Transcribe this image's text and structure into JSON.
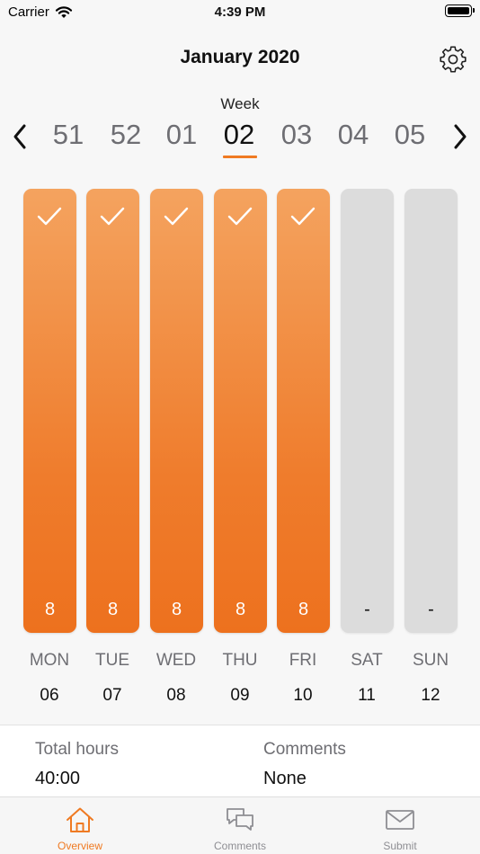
{
  "status_bar": {
    "carrier": "Carrier",
    "time": "4:39 PM"
  },
  "header": {
    "title": "January 2020"
  },
  "week_selector": {
    "label": "Week",
    "weeks": [
      "51",
      "52",
      "01",
      "02",
      "03",
      "04",
      "05"
    ],
    "selected": "02"
  },
  "days": [
    {
      "name": "MON",
      "date": "06",
      "hours": "8",
      "checked": true
    },
    {
      "name": "TUE",
      "date": "07",
      "hours": "8",
      "checked": true
    },
    {
      "name": "WED",
      "date": "08",
      "hours": "8",
      "checked": true
    },
    {
      "name": "THU",
      "date": "09",
      "hours": "8",
      "checked": true
    },
    {
      "name": "FRI",
      "date": "10",
      "hours": "8",
      "checked": true
    },
    {
      "name": "SAT",
      "date": "11",
      "hours": "-",
      "checked": false
    },
    {
      "name": "SUN",
      "date": "12",
      "hours": "-",
      "checked": false
    }
  ],
  "summary": {
    "total_hours_label": "Total hours",
    "total_hours_value": "40:00",
    "comments_label": "Comments",
    "comments_value": "None"
  },
  "tabs": [
    {
      "label": "Overview",
      "icon": "home-icon",
      "active": true
    },
    {
      "label": "Comments",
      "icon": "chat-bubbles-icon",
      "active": false
    },
    {
      "label": "Submit",
      "icon": "envelope-icon",
      "active": false
    }
  ],
  "colors": {
    "accent": "#ef7a22",
    "bar_empty": "#dcdcdc",
    "muted_text": "#6e6e73"
  }
}
